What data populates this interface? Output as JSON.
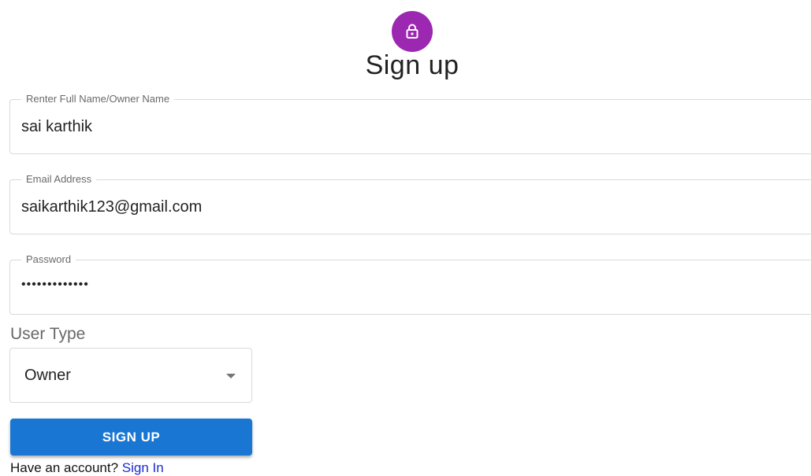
{
  "header": {
    "icon": "lock-icon",
    "title": "Sign up"
  },
  "form": {
    "name_field": {
      "label": "Renter Full Name/Owner Name",
      "value": "sai karthik"
    },
    "email_field": {
      "label": "Email Address",
      "value": "saikarthik123@gmail.com"
    },
    "password_field": {
      "label": "Password",
      "value": "•••••••••••••"
    },
    "user_type": {
      "label": "User Type",
      "selected": "Owner"
    },
    "submit_label": "SIGN UP"
  },
  "footer": {
    "prompt": "Have an account? ",
    "link_label": "Sign In"
  },
  "colors": {
    "avatar": "#9c27b0",
    "primary_button": "#1976d2",
    "link": "#1a2bd0"
  }
}
